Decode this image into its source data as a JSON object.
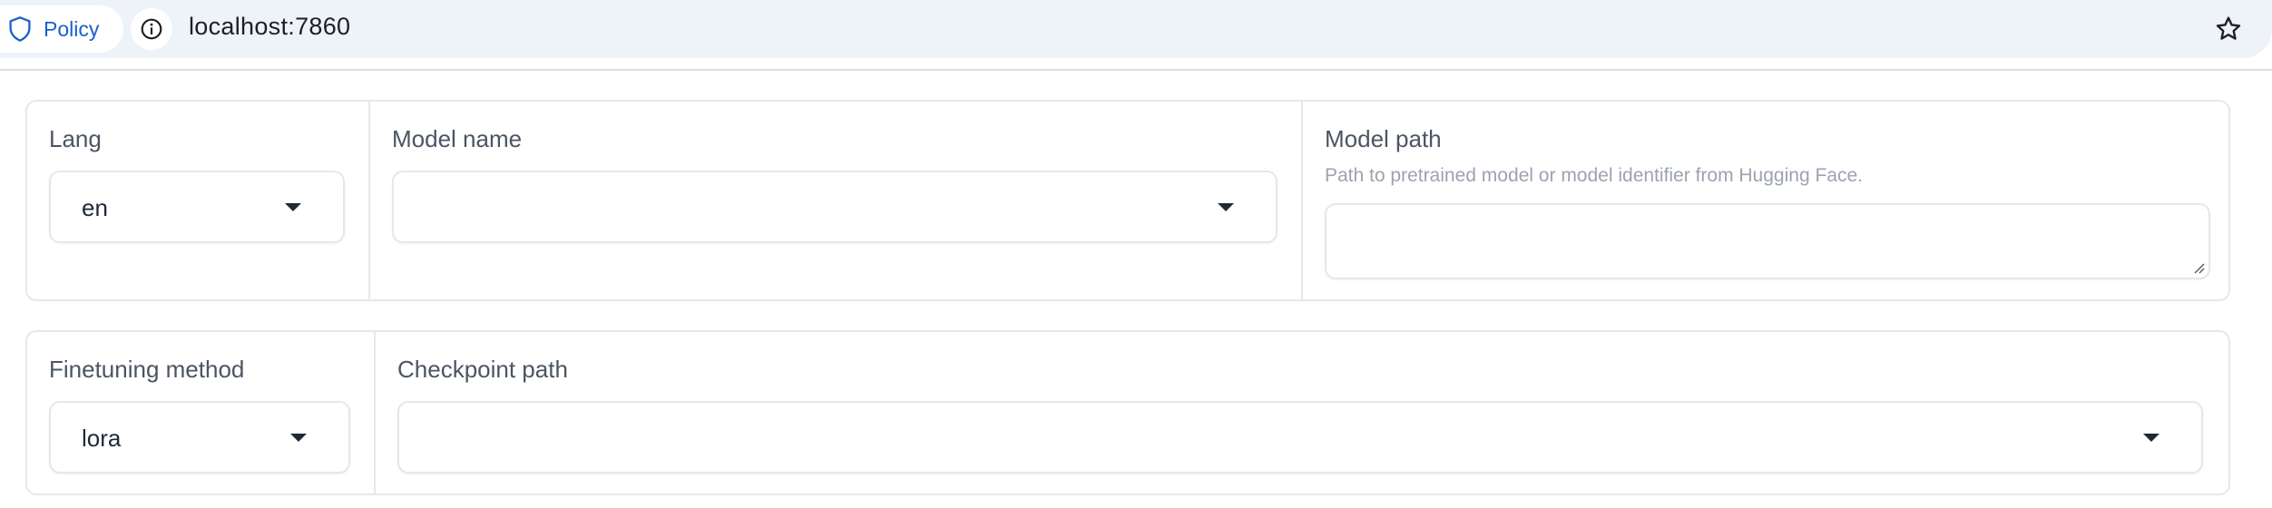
{
  "browser": {
    "policy_label": "Policy",
    "url": "localhost:7860",
    "icons": {
      "policy": "shield-icon",
      "info": "info-icon",
      "bookmark": "star-icon"
    },
    "accent_color": "#1a5fcc"
  },
  "panel_top": {
    "lang": {
      "label": "Lang",
      "value": "en"
    },
    "model_name": {
      "label": "Model name",
      "value": ""
    },
    "model_path": {
      "label": "Model path",
      "info": "Path to pretrained model or model identifier from Hugging Face.",
      "value": ""
    }
  },
  "panel_bottom": {
    "finetuning_method": {
      "label": "Finetuning method",
      "value": "lora"
    },
    "checkpoint_path": {
      "label": "Checkpoint path",
      "value": ""
    }
  }
}
